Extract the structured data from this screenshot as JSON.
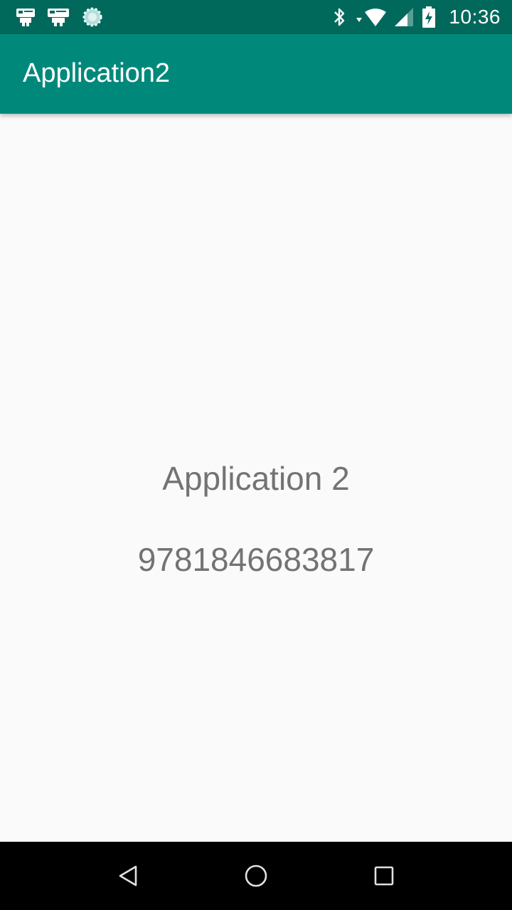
{
  "status_bar": {
    "time": "10:36",
    "left_icons": [
      "notification-app-icon",
      "notification-app-icon-2",
      "sync-spinner-icon"
    ],
    "right_icons": [
      "bluetooth-icon",
      "wifi-icon",
      "signal-icon",
      "battery-charging-icon"
    ],
    "color": "#00695c"
  },
  "app_bar": {
    "title": "Application2",
    "color": "#00897b"
  },
  "content": {
    "line1": "Application 2",
    "line2": "9781846683817",
    "text_color": "#737373"
  },
  "nav_bar": {
    "buttons": [
      "back-icon",
      "home-icon",
      "recents-icon"
    ]
  }
}
